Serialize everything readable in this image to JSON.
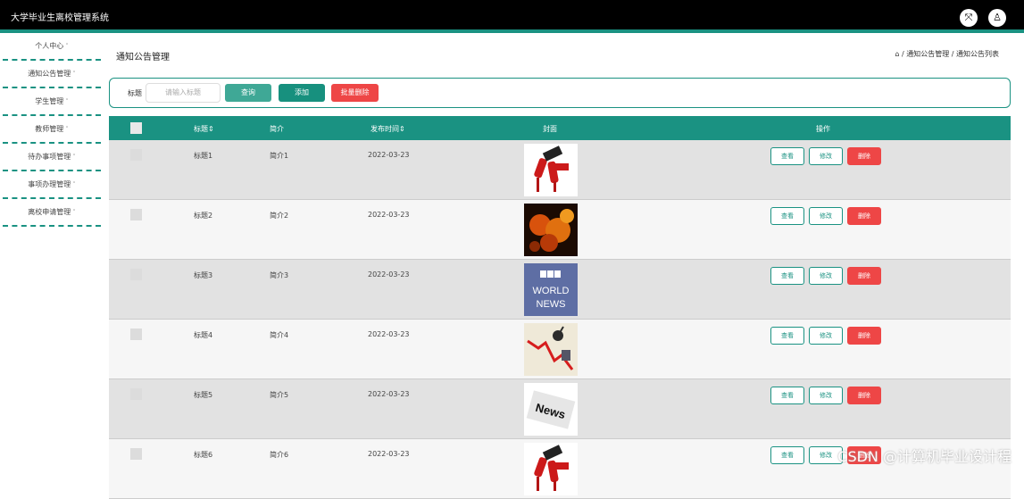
{
  "app": {
    "title": "大学毕业生离校管理系统"
  },
  "topbar": {
    "fullscreen_icon": "⤧",
    "user_icon": "♙"
  },
  "sidebar": {
    "items": [
      {
        "label": "个人中心"
      },
      {
        "label": "通知公告管理"
      },
      {
        "label": "学生管理"
      },
      {
        "label": "教师管理"
      },
      {
        "label": "待办事项管理"
      },
      {
        "label": "事项办理管理"
      },
      {
        "label": "离校申请管理"
      }
    ],
    "caret": "˅"
  },
  "page": {
    "title": "通知公告管理",
    "breadcrumb": "⌂ / 通知公告管理 / 通知公告列表"
  },
  "search": {
    "label": "标题",
    "placeholder": "请输入标题",
    "query_label": "查询",
    "add_label": "添加",
    "batch_delete_label": "批量删除"
  },
  "table": {
    "headers": {
      "title": "标题⇕",
      "intro": "简介",
      "publish_time": "发布时间⇕",
      "cover": "封面",
      "actions": "操作"
    },
    "actions": {
      "view": "查看",
      "edit": "修改",
      "delete": "删除"
    },
    "rows": [
      {
        "title": "标题1",
        "intro": "简介1",
        "date": "2022-03-23",
        "cover": "microphones"
      },
      {
        "title": "标题2",
        "intro": "简介2",
        "date": "2022-03-23",
        "cover": "fire-money"
      },
      {
        "title": "标题3",
        "intro": "简介3",
        "date": "2022-03-23",
        "cover": "bbc-world-news",
        "cover_text": [
          "BBC",
          "WORLD",
          "NEWS"
        ]
      },
      {
        "title": "标题4",
        "intro": "简介4",
        "date": "2022-03-23",
        "cover": "chart-down"
      },
      {
        "title": "标题5",
        "intro": "简介5",
        "date": "2022-03-23",
        "cover": "news-paper",
        "cover_text": [
          "News"
        ]
      },
      {
        "title": "标题6",
        "intro": "简介6",
        "date": "2022-03-23",
        "cover": "microphones"
      }
    ]
  },
  "watermark": "CSDN @计算机毕业设计程"
}
